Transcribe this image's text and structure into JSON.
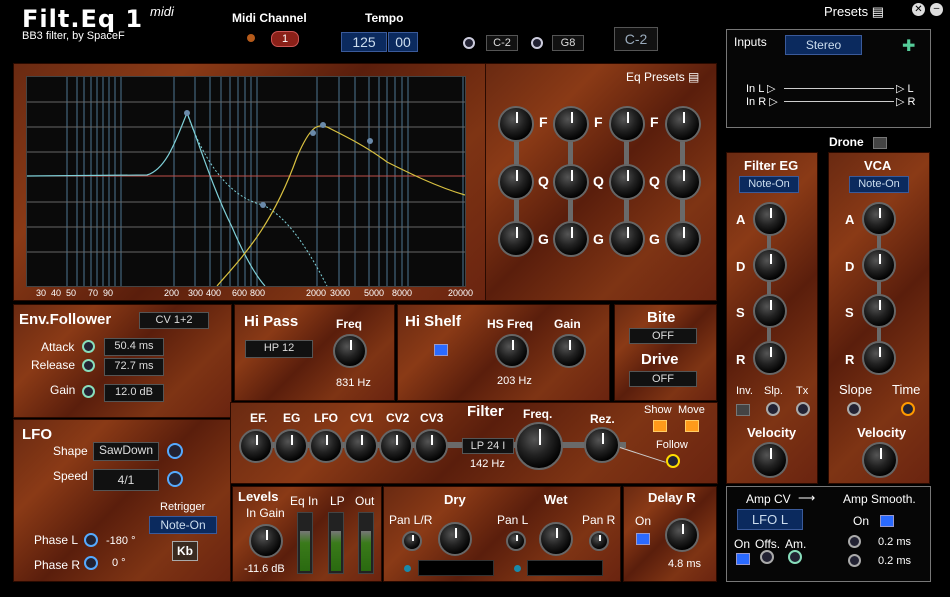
{
  "header": {
    "title": "Filt.Eq 1",
    "midi": "midi",
    "subtitle": "BB3 filter, by SpaceF",
    "midi_channel_label": "Midi Channel",
    "midi_channel": "1",
    "tempo_label": "Tempo",
    "tempo": "125",
    "tempo_frac": "00",
    "range_low": "C-2",
    "range_high": "G8",
    "note": "C-2",
    "presets": "Presets"
  },
  "graph": {
    "freq_labels": [
      "30",
      "40",
      "50",
      "70",
      "90",
      "200",
      "300",
      "400",
      "600",
      "800",
      "2000",
      "3000",
      "5000",
      "8000",
      "20000"
    ],
    "eq_presets": "Eq Presets"
  },
  "eqbank": {
    "f": "F",
    "q": "Q",
    "g": "G"
  },
  "inputs": {
    "label": "Inputs",
    "mode": "Stereo",
    "in_l": "In L",
    "in_r": "In R",
    "out_l": "L",
    "out_r": "R"
  },
  "drone": "Drone",
  "filter_eg": {
    "title": "Filter EG",
    "trigger": "Note-On",
    "a": "A",
    "d": "D",
    "s": "S",
    "r": "R",
    "inv": "Inv.",
    "slp": "Slp.",
    "tx": "Tx",
    "velocity": "Velocity"
  },
  "vca": {
    "title": "VCA",
    "trigger": "Note-On",
    "a": "A",
    "d": "D",
    "s": "S",
    "r": "R",
    "slope": "Slope",
    "time": "Time",
    "velocity": "Velocity"
  },
  "env": {
    "title": "Env.Follower",
    "source": "CV 1+2",
    "attack_label": "Attack",
    "attack": "50.4 ms",
    "release_label": "Release",
    "release": "72.7 ms",
    "gain_label": "Gain",
    "gain": "12.0 dB"
  },
  "hipass": {
    "title": "Hi Pass",
    "freq_label": "Freq",
    "type": "HP 12",
    "freq": "831 Hz"
  },
  "hishelf": {
    "title": "Hi Shelf",
    "freq_label": "HS Freq",
    "gain_label": "Gain",
    "freq": "203 Hz"
  },
  "bite": {
    "title": "Bite",
    "value": "OFF"
  },
  "drive": {
    "title": "Drive",
    "value": "OFF"
  },
  "filter": {
    "mods": [
      "EF.",
      "EG",
      "LFO",
      "CV1",
      "CV2",
      "CV3"
    ],
    "title": "Filter",
    "freq_label": "Freq.",
    "rez_label": "Rez.",
    "type": "LP 24 I",
    "freq": "142 Hz",
    "show": "Show",
    "move": "Move",
    "follow": "Follow"
  },
  "lfo": {
    "title": "LFO",
    "shape_label": "Shape",
    "shape": "SawDown",
    "speed_label": "Speed",
    "speed": "4/1",
    "retrigger_label": "Retrigger",
    "retrigger": "Note-On",
    "phase_l_label": "Phase L",
    "phase_l": "-180 °",
    "phase_r_label": "Phase R",
    "phase_r": "0 °",
    "kb": "Kb"
  },
  "levels": {
    "title": "Levels",
    "in_gain_label": "In Gain",
    "in_gain": "-11.6 dB",
    "eq_in": "Eq In",
    "lp": "LP",
    "out": "Out"
  },
  "dry": {
    "title": "Dry",
    "pan_label": "Pan L/R"
  },
  "wet": {
    "title": "Wet",
    "pan_l": "Pan L",
    "pan_r": "Pan R"
  },
  "delay": {
    "title": "Delay R",
    "on": "On",
    "value": "4.8 ms"
  },
  "amp": {
    "cv_label": "Amp CV",
    "smooth_label": "Amp Smooth.",
    "source": "LFO L",
    "on": "On",
    "offs": "Offs.",
    "am": "Am.",
    "smooth_on": "On",
    "t1": "0.2 ms",
    "t2": "0.2 ms"
  }
}
